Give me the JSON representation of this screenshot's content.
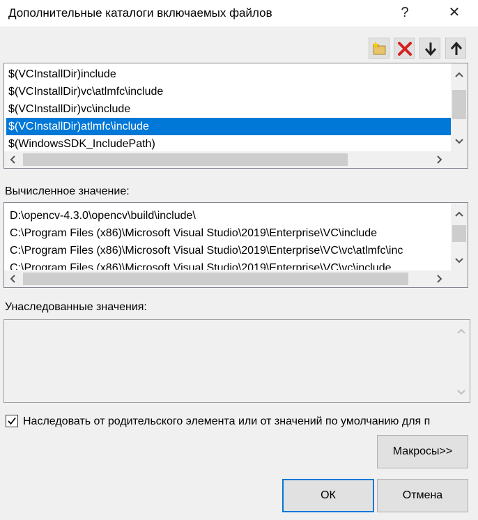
{
  "window": {
    "title": "Дополнительные каталоги включаемых файлов",
    "help_glyph": "?",
    "close_glyph": "✕"
  },
  "toolbar": {
    "icons": [
      "new-line-icon",
      "delete-icon",
      "move-down-icon",
      "move-up-icon"
    ]
  },
  "include_list": {
    "items": [
      {
        "label": "$(VCInstallDir)include",
        "selected": false
      },
      {
        "label": "$(VCInstallDir)vc\\atlmfc\\include",
        "selected": false
      },
      {
        "label": "$(VCInstallDir)vc\\include",
        "selected": false
      },
      {
        "label": "$(VCInstallDir)atlmfc\\include",
        "selected": true
      },
      {
        "label": "$(WindowsSDK_IncludePath)",
        "selected": false
      }
    ]
  },
  "evaluated": {
    "label": "Вычисленное значение:",
    "items": [
      "D:\\opencv-4.3.0\\opencv\\build\\include\\",
      "C:\\Program Files (x86)\\Microsoft Visual Studio\\2019\\Enterprise\\VC\\include",
      "C:\\Program Files (x86)\\Microsoft Visual Studio\\2019\\Enterprise\\VC\\vc\\atlmfc\\inc",
      "C:\\Program Files (x86)\\Microsoft Visual Studio\\2019\\Enterprise\\VC\\vc\\include"
    ]
  },
  "inherited": {
    "label": "Унаследованные значения:"
  },
  "inherit_checkbox": {
    "label": "Наследовать от родительского элемента или от значений по умолчанию для п",
    "checked": true
  },
  "buttons": {
    "macros": "Макросы>>",
    "ok": "ОК",
    "cancel": "Отмена"
  },
  "colors": {
    "selection": "#0078d7",
    "window_bg": "#f0f0f0"
  }
}
